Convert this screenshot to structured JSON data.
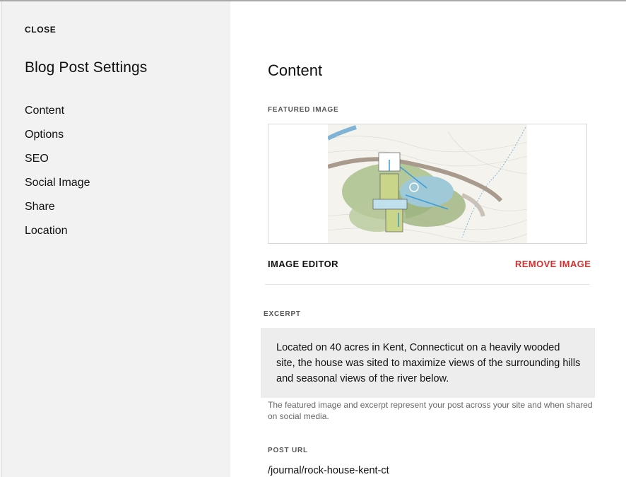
{
  "sidebar": {
    "close_label": "CLOSE",
    "title": "Blog Post Settings",
    "items": [
      {
        "label": "Content"
      },
      {
        "label": "Options"
      },
      {
        "label": "SEO"
      },
      {
        "label": "Social Image"
      },
      {
        "label": "Share"
      },
      {
        "label": "Location"
      }
    ]
  },
  "main": {
    "title": "Content",
    "featured_image": {
      "label": "FEATURED IMAGE",
      "editor_label": "IMAGE EDITOR",
      "remove_label": "REMOVE IMAGE"
    },
    "excerpt": {
      "label": "EXCERPT",
      "text": "Located on 40 acres in Kent, Connecticut on a heavily wooded site, the house was sited to maximize views of the surrounding hills and seasonal views of the river below.",
      "helper": "The featured image and excerpt represent your post across your site and when shared on social media."
    },
    "post_url": {
      "label": "POST URL",
      "value": "/journal/rock-house-kent-ct"
    }
  },
  "colors": {
    "accent_remove": "#d32f2f",
    "sidebar_bg": "#f2f2f2",
    "excerpt_bg": "#ededed"
  }
}
